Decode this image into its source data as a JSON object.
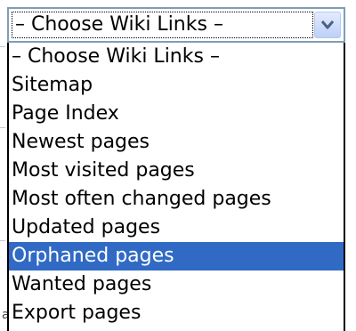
{
  "dropdown": {
    "selected_value": "– Choose Wiki Links –",
    "options": [
      "– Choose Wiki Links –",
      "Sitemap",
      "Page Index",
      "Newest pages",
      "Most visited pages",
      "Most often changed pages",
      "Updated pages",
      "Orphaned pages",
      "Wanted pages",
      "Export pages"
    ],
    "highlighted_option": "Orphaned pages",
    "arrow_icon": "chevron-down-icon"
  },
  "page_fragment": {
    "text": "a"
  },
  "colors": {
    "highlight": "#316ac5",
    "border": "#7f9db9",
    "arrow_button": "#bcd0f8"
  }
}
